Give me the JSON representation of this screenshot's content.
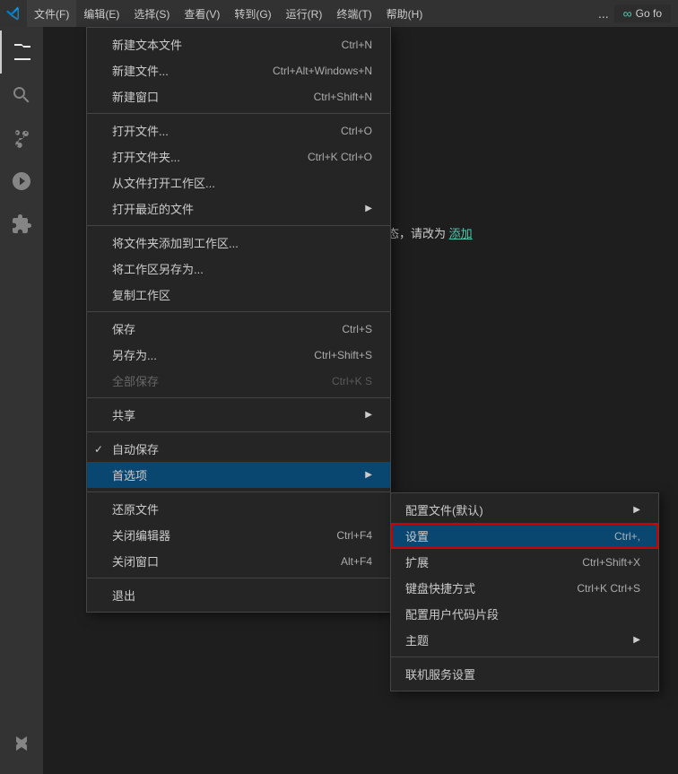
{
  "titlebar": {
    "logo": "◈",
    "menus": [
      {
        "id": "file",
        "label": "文件(F)",
        "active": true
      },
      {
        "id": "edit",
        "label": "编辑(E)"
      },
      {
        "id": "select",
        "label": "选择(S)"
      },
      {
        "id": "view",
        "label": "查看(V)"
      },
      {
        "id": "goto",
        "label": "转到(G)"
      },
      {
        "id": "run",
        "label": "运行(R)"
      },
      {
        "id": "terminal",
        "label": "终端(T)"
      },
      {
        "id": "help",
        "label": "帮助(H)"
      }
    ],
    "ellipsis": "...",
    "go_for_label": "Go fo"
  },
  "activity_bar": {
    "icons": [
      {
        "id": "files",
        "symbol": "⧉"
      },
      {
        "id": "search",
        "symbol": "⚲"
      },
      {
        "id": "source-control",
        "symbol": "⎇"
      },
      {
        "id": "run-debug",
        "symbol": "▷"
      },
      {
        "id": "extensions",
        "symbol": "⊞"
      },
      {
        "id": "testing",
        "symbol": "⚗"
      }
    ]
  },
  "file_menu": {
    "items": [
      {
        "id": "new-text-file",
        "label": "新建文本文件",
        "shortcut": "Ctrl+N"
      },
      {
        "id": "new-file",
        "label": "新建文件...",
        "shortcut": "Ctrl+Alt+Windows+N"
      },
      {
        "id": "new-window",
        "label": "新建窗口",
        "shortcut": "Ctrl+Shift+N"
      },
      {
        "id": "sep1",
        "type": "separator"
      },
      {
        "id": "open-file",
        "label": "打开文件...",
        "shortcut": "Ctrl+O"
      },
      {
        "id": "open-folder",
        "label": "打开文件夹...",
        "shortcut": "Ctrl+K Ctrl+O"
      },
      {
        "id": "open-workspace",
        "label": "从文件打开工作区..."
      },
      {
        "id": "open-recent",
        "label": "打开最近的文件",
        "hasArrow": true
      },
      {
        "id": "sep2",
        "type": "separator"
      },
      {
        "id": "add-folder",
        "label": "将文件夹添加到工作区..."
      },
      {
        "id": "save-workspace",
        "label": "将工作区另存为..."
      },
      {
        "id": "duplicate-workspace",
        "label": "复制工作区"
      },
      {
        "id": "sep3",
        "type": "separator"
      },
      {
        "id": "save",
        "label": "保存",
        "shortcut": "Ctrl+S"
      },
      {
        "id": "save-as",
        "label": "另存为...",
        "shortcut": "Ctrl+Shift+S"
      },
      {
        "id": "save-all",
        "label": "全部保存",
        "shortcut": "Ctrl+K S",
        "disabled": true
      },
      {
        "id": "sep4",
        "type": "separator"
      },
      {
        "id": "share",
        "label": "共享",
        "hasArrow": true
      },
      {
        "id": "sep5",
        "type": "separator"
      },
      {
        "id": "auto-save",
        "label": "自动保存",
        "hasCheck": true
      },
      {
        "id": "preferences",
        "label": "首选项",
        "hasArrow": true,
        "highlighted": true
      },
      {
        "id": "sep6",
        "type": "separator"
      },
      {
        "id": "revert-file",
        "label": "还原文件"
      },
      {
        "id": "close-editor",
        "label": "关闭编辑器",
        "shortcut": "Ctrl+F4"
      },
      {
        "id": "close-window",
        "label": "关闭窗口",
        "shortcut": "Alt+F4"
      },
      {
        "id": "sep7",
        "type": "separator"
      },
      {
        "id": "exit",
        "label": "退出"
      }
    ]
  },
  "preferences_submenu": {
    "items": [
      {
        "id": "default-profile",
        "label": "配置文件(默认)",
        "hasArrow": true
      },
      {
        "id": "settings",
        "label": "设置",
        "shortcut": "Ctrl+,",
        "highlighted": true
      },
      {
        "id": "extensions",
        "label": "扩展",
        "shortcut": "Ctrl+Shift+X"
      },
      {
        "id": "keyboard-shortcuts",
        "label": "键盘快捷方式",
        "shortcut": "Ctrl+K Ctrl+S"
      },
      {
        "id": "user-snippets",
        "label": "配置用户代码片段"
      },
      {
        "id": "theme",
        "label": "主题",
        "hasArrow": true
      },
      {
        "id": "sep1",
        "type": "separator"
      },
      {
        "id": "online-services",
        "label": "联机服务设置"
      }
    ]
  },
  "background": {
    "text_before_link": "如需其保持打开状态，请改为",
    "link_text": "添加",
    "blue_button_label": ""
  }
}
